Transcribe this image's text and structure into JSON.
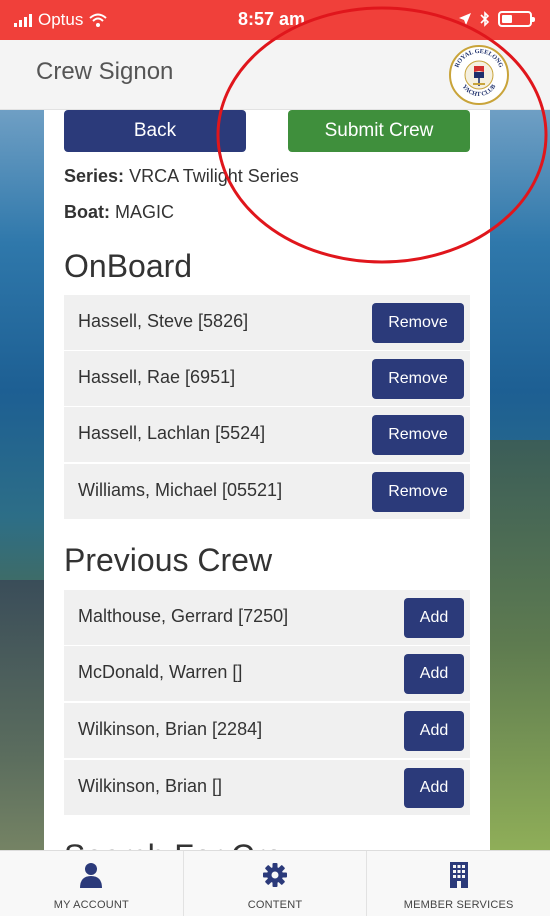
{
  "status_bar": {
    "carrier": "Optus",
    "time": "8:57 am"
  },
  "header": {
    "title": "Crew Signon",
    "logo_text": "ROYAL GEELONG YACHT CLUB"
  },
  "actions": {
    "back_label": "Back",
    "submit_label": "Submit Crew"
  },
  "info": {
    "series_label": "Series:",
    "series_value": "VRCA Twilight Series",
    "boat_label": "Boat:",
    "boat_value": "MAGIC"
  },
  "onboard": {
    "title": "OnBoard",
    "button_label": "Remove",
    "members": [
      {
        "name": "Hassell, Steve [5826]"
      },
      {
        "name": "Hassell, Rae [6951]"
      },
      {
        "name": "Hassell, Lachlan [5524]"
      },
      {
        "name": "Williams, Michael [05521]"
      }
    ]
  },
  "previous_crew": {
    "title": "Previous Crew",
    "button_label": "Add",
    "members": [
      {
        "name": "Malthouse, Gerrard [7250]"
      },
      {
        "name": "McDonald, Warren []"
      },
      {
        "name": "Wilkinson, Brian [2284]"
      },
      {
        "name": "Wilkinson, Brian []"
      }
    ]
  },
  "next_section_partial": "Search For Crew",
  "tabs": [
    {
      "label": "MY ACCOUNT",
      "icon": "person-icon"
    },
    {
      "label": "CONTENT",
      "icon": "gear-icon"
    },
    {
      "label": "MEMBER SERVICES",
      "icon": "building-icon"
    }
  ],
  "colors": {
    "status_bar": "#f0403a",
    "primary": "#2b3a7a",
    "success": "#3f8f3c",
    "annotation": "#e0161c"
  }
}
